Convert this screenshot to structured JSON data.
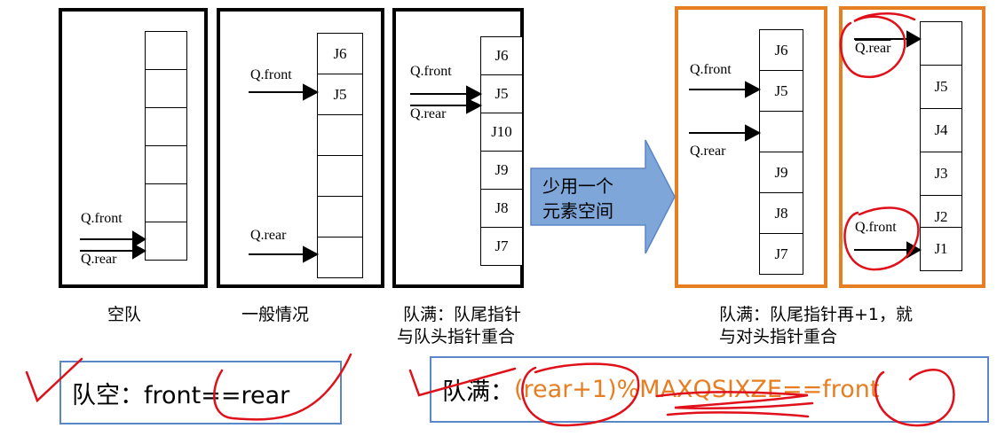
{
  "panels": [
    {
      "caption": "空队",
      "labels": [
        "Q.front",
        "Q.rear"
      ],
      "cells": [
        "",
        "",
        "",
        "",
        "",
        ""
      ]
    },
    {
      "caption": "一般情况",
      "labels": [
        "Q.front",
        "Q.rear"
      ],
      "cells": [
        "J6",
        "J5",
        "",
        "",
        "",
        ""
      ]
    },
    {
      "caption_lines": [
        "队满：队尾指针",
        "与队头指针重合"
      ],
      "labels": [
        "Q.front",
        "Q.rear"
      ],
      "cells": [
        "J6",
        "J5",
        "J10",
        "J9",
        "J8",
        "J7"
      ]
    },
    {
      "labels": [
        "Q.front",
        "Q.rear"
      ],
      "cells": [
        "J6",
        "J5",
        "",
        "J9",
        "J8",
        "J7"
      ]
    },
    {
      "labels": [
        "Q.rear",
        "Q.front"
      ],
      "cells": [
        "",
        "J5",
        "J4",
        "J3",
        "J2",
        "J1"
      ]
    }
  ],
  "right_caption_lines": [
    "队满：队尾指针再+1，就",
    "与对头指针重合"
  ],
  "arrow_text_lines": [
    "少用一个",
    "元素空间"
  ],
  "formula_empty": "队空：front==rear",
  "formula_full": {
    "prefix": "队满：",
    "expr": "(rear+1)%MAXQSIXZE==front"
  },
  "colors": {
    "panel_black": "#000000",
    "panel_orange": "#e67e22",
    "arrow_fill": "#7ea6d8",
    "formula_border": "#5b86c7",
    "expr_orange": "#e67e22",
    "ink_red": "#e0101a"
  }
}
